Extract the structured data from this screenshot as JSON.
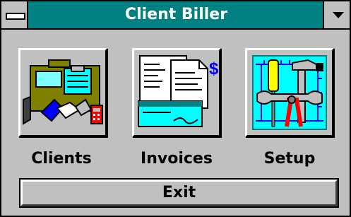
{
  "window": {
    "title": "Client Biller"
  },
  "buttons": {
    "clients": {
      "label": "Clients",
      "icon": "briefcase-handshake-icon"
    },
    "invoices": {
      "label": "Invoices",
      "icon": "invoice-dollar-icon"
    },
    "setup": {
      "label": "Setup",
      "icon": "tools-icon"
    }
  },
  "exit": {
    "label": "Exit"
  },
  "colors": {
    "titlebar": "#008080",
    "face": "#c0c0c0"
  }
}
